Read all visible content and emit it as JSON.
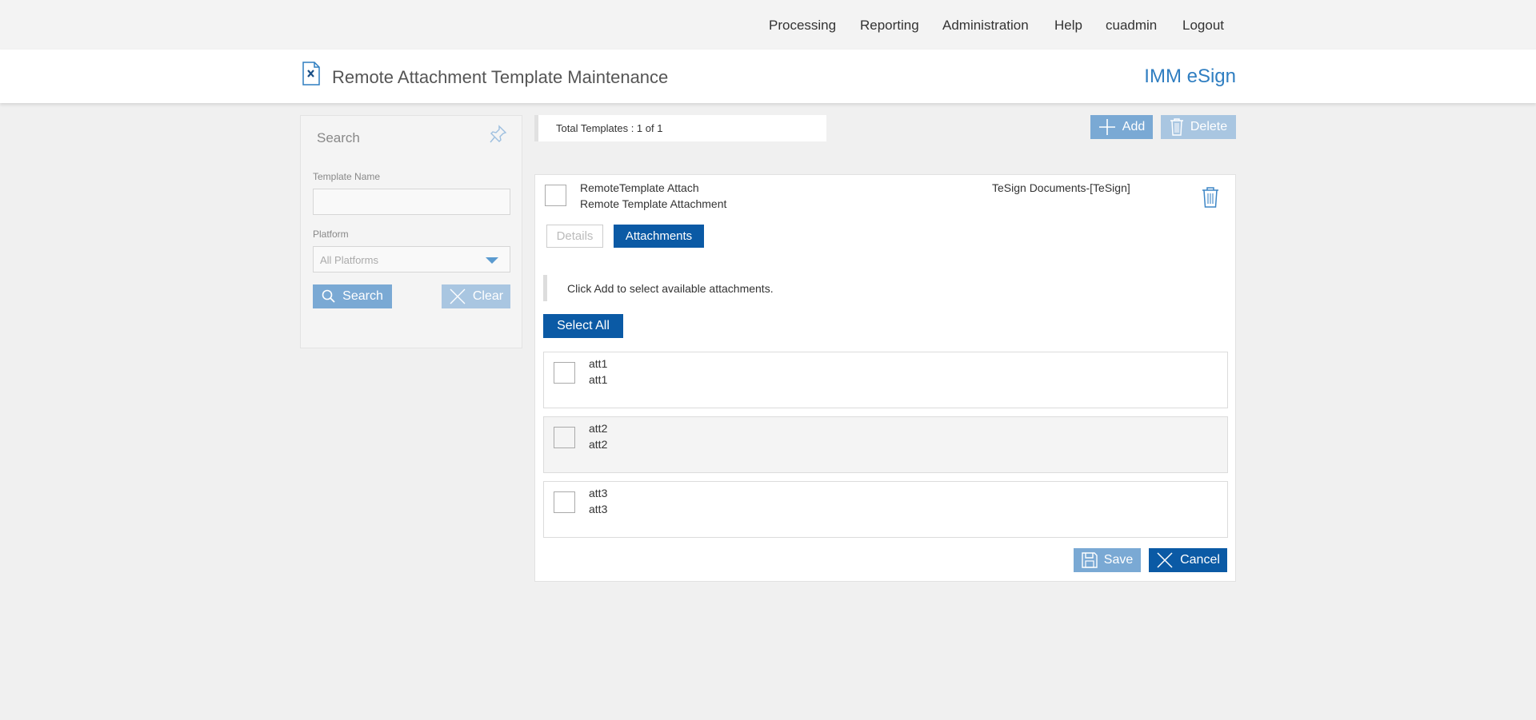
{
  "nav": {
    "items": [
      "Processing",
      "Reporting",
      "Administration",
      "Help",
      "cuadmin",
      "Logout"
    ]
  },
  "header": {
    "title": "Remote Attachment Template Maintenance",
    "brand": "IMM eSign"
  },
  "search_panel": {
    "title": "Search",
    "template_name_label": "Template Name",
    "template_name_value": "",
    "platform_label": "Platform",
    "platform_value": "All Platforms",
    "search_label": "Search",
    "clear_label": "Clear"
  },
  "toolbar": {
    "total_text": "Total Templates : 1 of 1",
    "add_label": "Add",
    "delete_label": "Delete"
  },
  "template": {
    "name": "RemoteTemplate Attach",
    "description": "Remote Template Attachment",
    "platform": "TeSign Documents-[TeSign]",
    "tabs": [
      "Details",
      "Attachments"
    ],
    "active_tab": "Attachments",
    "hint": "Click Add to select available attachments.",
    "select_all_label": "Select All",
    "attachments": [
      {
        "name": "att1",
        "description": "att1"
      },
      {
        "name": "att2",
        "description": "att2"
      },
      {
        "name": "att3",
        "description": "att3"
      }
    ],
    "save_label": "Save",
    "cancel_label": "Cancel"
  },
  "colors": {
    "accent": "#0b5aa5",
    "brand": "#2f7ec1",
    "light_button": "#7aa9d4"
  }
}
